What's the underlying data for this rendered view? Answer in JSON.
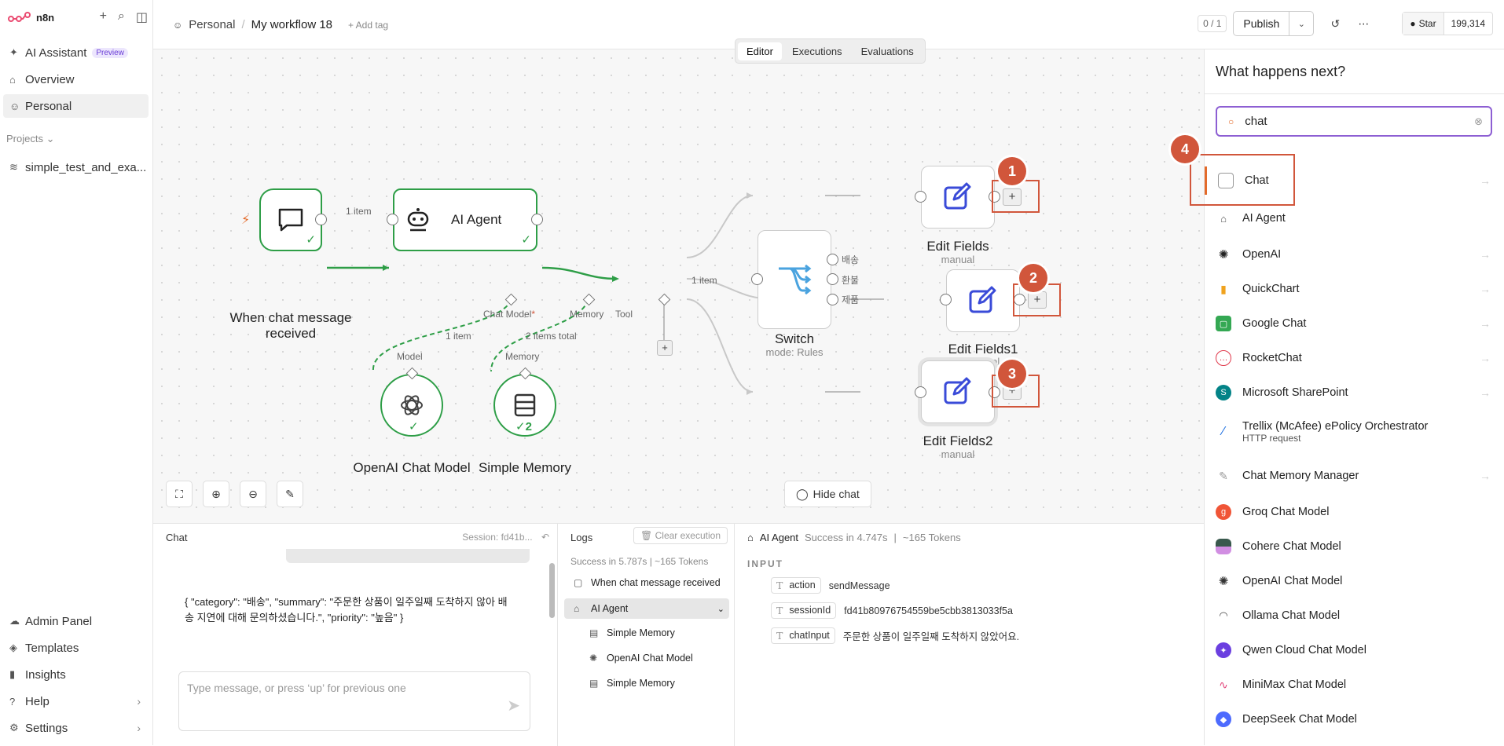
{
  "app": {
    "name": "n8n"
  },
  "sidebar": {
    "items": [
      {
        "label": "AI Assistant",
        "badge": "Preview"
      },
      {
        "label": "Overview"
      },
      {
        "label": "Personal"
      }
    ],
    "projects_label": "Projects",
    "projects": [
      {
        "label": "simple_test_and_exa..."
      }
    ],
    "bottom": [
      {
        "label": "Admin Panel"
      },
      {
        "label": "Templates"
      },
      {
        "label": "Insights"
      },
      {
        "label": "Help"
      },
      {
        "label": "Settings"
      }
    ]
  },
  "header": {
    "breadcrumb_owner": "Personal",
    "workflow_name": "My workflow 18",
    "add_tag": "+ Add tag",
    "counter": "0 / 1",
    "publish_label": "Publish",
    "github_star_label": "Star",
    "github_stars": "199,314"
  },
  "canvas_tabs": [
    "Editor",
    "Executions",
    "Evaluations"
  ],
  "nodes": {
    "trigger": {
      "label": "When chat message received"
    },
    "agent": {
      "label": "AI Agent"
    },
    "switch": {
      "label": "Switch",
      "sub": "mode: Rules"
    },
    "edit1": {
      "label": "Edit Fields",
      "sub": "manual"
    },
    "edit2": {
      "label": "Edit Fields1",
      "sub": "manual"
    },
    "edit3": {
      "label": "Edit Fields2",
      "sub": "manual"
    },
    "openai": {
      "label": "OpenAI Chat Model"
    },
    "memory": {
      "label": "Simple Memory",
      "count": "2"
    }
  },
  "edge_labels": {
    "trigger_agent": "1 item",
    "agent_switch": "1 item",
    "model_items": "1 item",
    "memory_items": "2 items total",
    "chat_model_port": "Chat Model",
    "chat_model_required": "*",
    "memory_port": "Memory",
    "tool_port": "Tool",
    "model_in": "Model",
    "memory_in": "Memory"
  },
  "switch_outputs": [
    "배송",
    "환불",
    "제품"
  ],
  "annotations": [
    "1",
    "2",
    "3",
    "4"
  ],
  "canvas_controls": {
    "hide_chat": "Hide chat"
  },
  "chat": {
    "title": "Chat",
    "session": "Session: fd41b...",
    "message": "{ \"category\": \"배송\", \"summary\": \"주문한 상품이 일주일째 도착하지 않아 배송 지연에 대해 문의하셨습니다.\", \"priority\": \"높음\" }",
    "input_placeholder": "Type message, or press ‘up’ for previous one"
  },
  "logs": {
    "title": "Logs",
    "clear": "Clear execution",
    "status": "Success in 5.787s  |  ~165 Tokens",
    "rows": [
      {
        "label": "When chat message received"
      },
      {
        "label": "AI Agent"
      },
      {
        "label": "Simple Memory"
      },
      {
        "label": "OpenAI Chat Model"
      },
      {
        "label": "Simple Memory"
      }
    ]
  },
  "detail": {
    "node": "AI Agent",
    "status": "Success in 4.747s",
    "tokens": "~165 Tokens",
    "section": "INPUT",
    "fields": [
      {
        "key": "action",
        "value": "sendMessage"
      },
      {
        "key": "sessionId",
        "value": "fd41b80976754559be5cbb3813033f5a"
      },
      {
        "key": "chatInput",
        "value": "주문한 상품이 일주일째 도착하지 않았어요."
      }
    ]
  },
  "panel": {
    "title": "What happens next?",
    "search_value": "chat",
    "items": [
      {
        "label": "Chat"
      },
      {
        "label": "AI Agent"
      },
      {
        "label": "OpenAI"
      },
      {
        "label": "QuickChart"
      },
      {
        "label": "Google Chat"
      },
      {
        "label": "RocketChat"
      },
      {
        "label": "Microsoft SharePoint"
      },
      {
        "label": "Trellix (McAfee) ePolicy Orchestrator",
        "sub": "HTTP request"
      },
      {
        "label": "Chat Memory Manager"
      },
      {
        "label": "Groq Chat Model"
      },
      {
        "label": "Cohere Chat Model"
      },
      {
        "label": "OpenAI Chat Model"
      },
      {
        "label": "Ollama Chat Model"
      },
      {
        "label": "Qwen Cloud Chat Model"
      },
      {
        "label": "MiniMax Chat Model"
      },
      {
        "label": "DeepSeek Chat Model"
      }
    ]
  },
  "colors": {
    "accent": "#d1563b",
    "success": "#2e9e47",
    "search_border": "#8d5fd3",
    "brand": "#ea4b71"
  }
}
